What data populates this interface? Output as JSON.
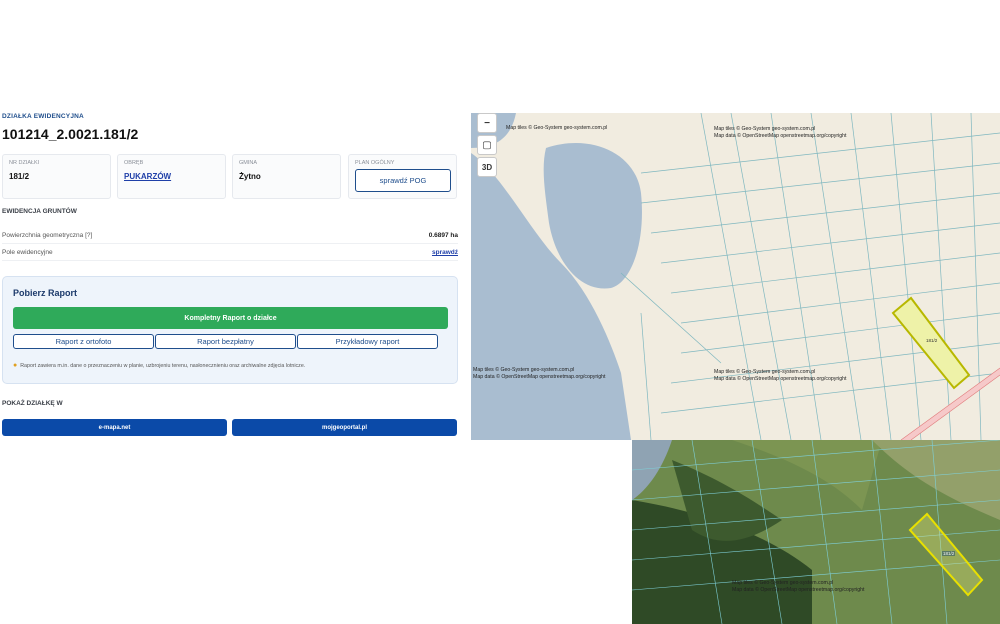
{
  "plot": {
    "kicker": "DZIAŁKA EWIDENCYJNA",
    "id": "101214_2.0021.181/2"
  },
  "cards": {
    "nr_label": "NR DZIAŁKI",
    "nr_value": "181/2",
    "obreb_label": "OBRĘB",
    "obreb_value": "PUKARZÓW",
    "gmina_label": "GMINA",
    "gmina_value": "Żytno",
    "plan_label": "PLAN OGÓLNY",
    "plan_button": "sprawdź POG"
  },
  "ewidencja": {
    "heading": "EWIDENCJA GRUNTÓW",
    "area_label": "Powierzchnia geometryczna [?]",
    "area_value": "0.6897 ha",
    "pole_label": "Pole ewidencyjne",
    "pole_value": "sprawdź"
  },
  "report": {
    "title": "Pobierz Raport",
    "full_button": "Kompletny Raport o działce",
    "ortho_button": "Raport z ortofoto",
    "free_button": "Raport bezpłatny",
    "sample_button": "Przykładowy raport",
    "note": "Raport zawiera m.in. dane o przeznaczeniu w planie, uzbrojeniu terenu, nasłonecznieniu oraz archiwalne zdjęcia lotnicze."
  },
  "show": {
    "heading": "POKAŻ DZIAŁKĘ W",
    "emapa": "e-mapa.net",
    "mojgeo": "mojgeoportal.pl"
  },
  "map": {
    "ctl_3d": "3D",
    "attribution_tiles": "Map tiles © Geo-System geo-system.com.pl",
    "attribution_data": "Map data © OpenStreetMap openstreetmap.org/copyright",
    "plot_label": "181/2"
  },
  "colors": {
    "brand": "#1f4e8c",
    "green": "#2faa5a",
    "blue": "#0b4aa8",
    "water": "#a9bdd0",
    "plot_outline": "#b8b800"
  }
}
